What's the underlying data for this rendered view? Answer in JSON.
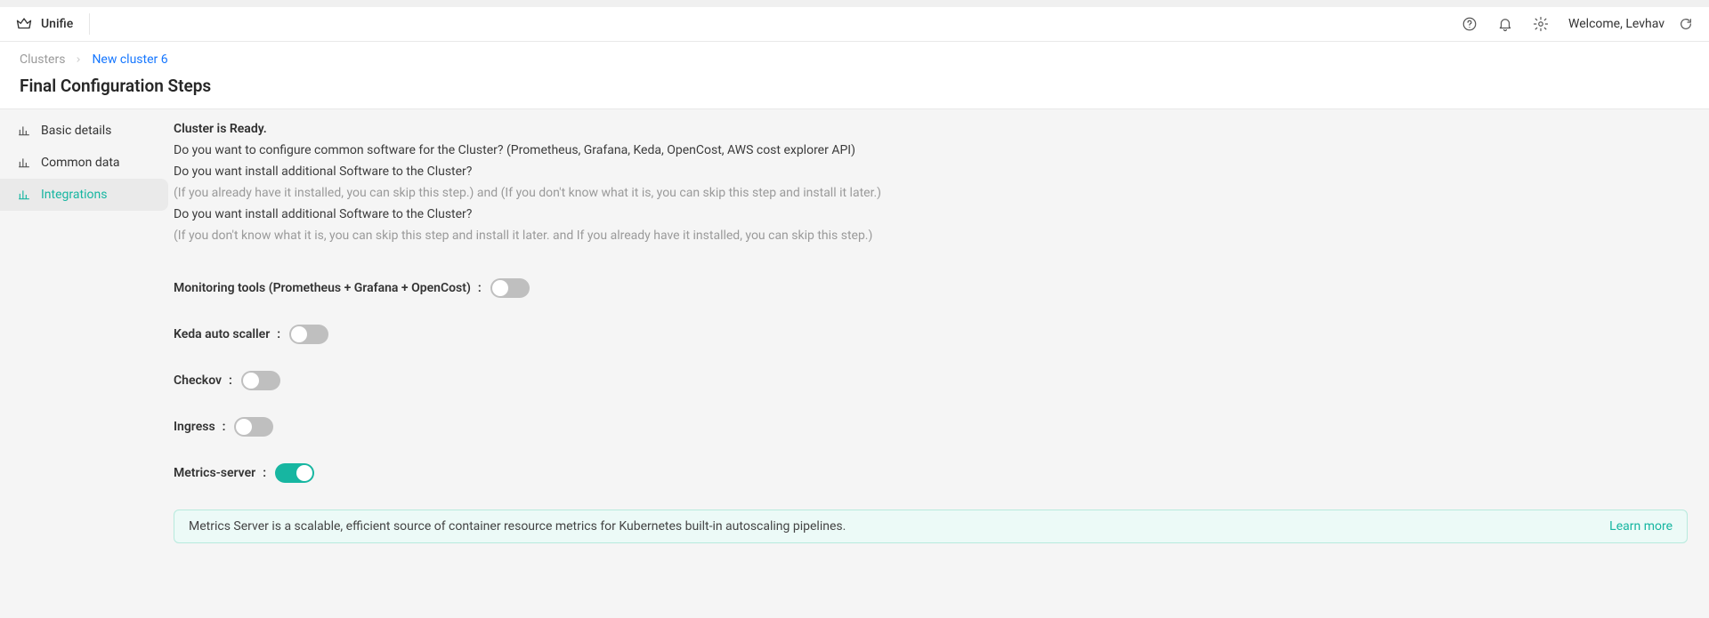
{
  "header": {
    "brand": "Unifie",
    "welcome": "Welcome, Levhav"
  },
  "breadcrumb": {
    "root": "Clusters",
    "current": "New cluster 6"
  },
  "page": {
    "title": "Final Configuration Steps"
  },
  "sidebar": {
    "items": [
      {
        "label": "Basic details"
      },
      {
        "label": "Common data"
      },
      {
        "label": "Integrations"
      }
    ]
  },
  "main": {
    "ready": "Cluster is Ready.",
    "line1": "Do you want to configure common software for the Cluster? (Prometheus, Grafana, Keda, OpenCost, AWS cost explorer API)",
    "line2": "Do you want install additional Software to the Cluster?",
    "note1": "(If you already have it installed, you can skip this step.) and (If you don't know what it is, you can skip this step and install it later.)",
    "line3": "Do you want install additional Software to the Cluster?",
    "note2": "(If you don't know what it is, you can skip this step and install it later. and If you already have it installed, you can skip this step.)",
    "toggles": {
      "monitoring": {
        "label": "Monitoring tools (Prometheus + Grafana + OpenCost)",
        "on": false
      },
      "keda": {
        "label": "Keda auto scaller",
        "on": false
      },
      "checkov": {
        "label": "Checkov",
        "on": false
      },
      "ingress": {
        "label": "Ingress",
        "on": false
      },
      "metrics": {
        "label": "Metrics-server",
        "on": true
      }
    },
    "banner": {
      "text": "Metrics Server is a scalable, efficient source of container resource metrics for Kubernetes built-in autoscaling pipelines.",
      "learn": "Learn more"
    }
  }
}
